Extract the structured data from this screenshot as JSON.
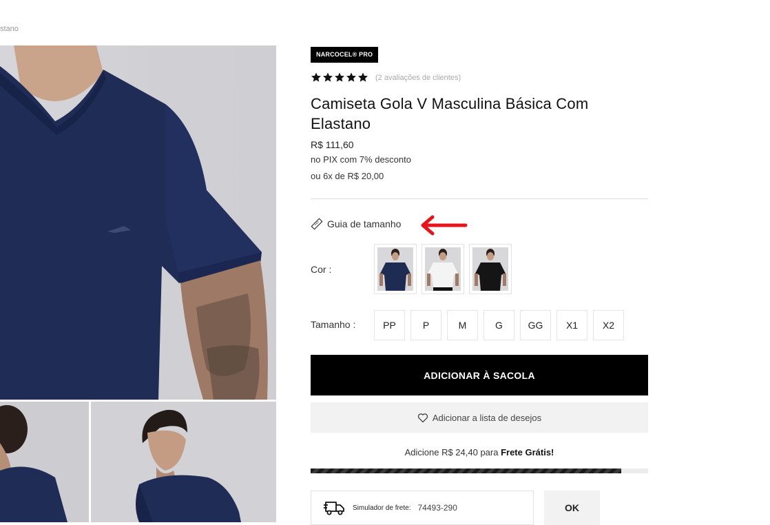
{
  "breadcrumb": {
    "text": "stano"
  },
  "product": {
    "brand": "NARCOCEL® PRO",
    "rating": 5,
    "reviews_text": "(2 avaliações de clientes)",
    "title": "Camiseta Gola V Masculina Básica Com Elastano",
    "price": "R$ 111,60",
    "pix_text": "no PIX com 7% desconto",
    "installments": "ou 6x de R$ 20,00"
  },
  "size_guide": {
    "label": "Guia de tamanho",
    "icon": "ruler-icon"
  },
  "color_selector": {
    "label": "Cor :",
    "options": [
      {
        "name": "navy",
        "shirt_color": "#1e2b52"
      },
      {
        "name": "white",
        "shirt_color": "#f4f4f4"
      },
      {
        "name": "black",
        "shirt_color": "#151515"
      }
    ]
  },
  "size_selector": {
    "label": "Tamanho :",
    "options": [
      "PP",
      "P",
      "M",
      "G",
      "GG",
      "X1",
      "X2"
    ]
  },
  "actions": {
    "add_to_bag": "ADICIONAR À SACOLA",
    "wishlist": "Adicionar a lista de desejos"
  },
  "shipping": {
    "message_prefix": "Adicione R$ 24,40 para ",
    "message_bold": "Frete Grátis!",
    "progress_percent": 92,
    "simulator_label": "Simulador de frete:",
    "simulator_value": "74493-290",
    "ok_label": "OK"
  },
  "colors": {
    "accent": "#000000",
    "arrow": "#e8141b",
    "shirt_navy": "#1e2b52"
  }
}
